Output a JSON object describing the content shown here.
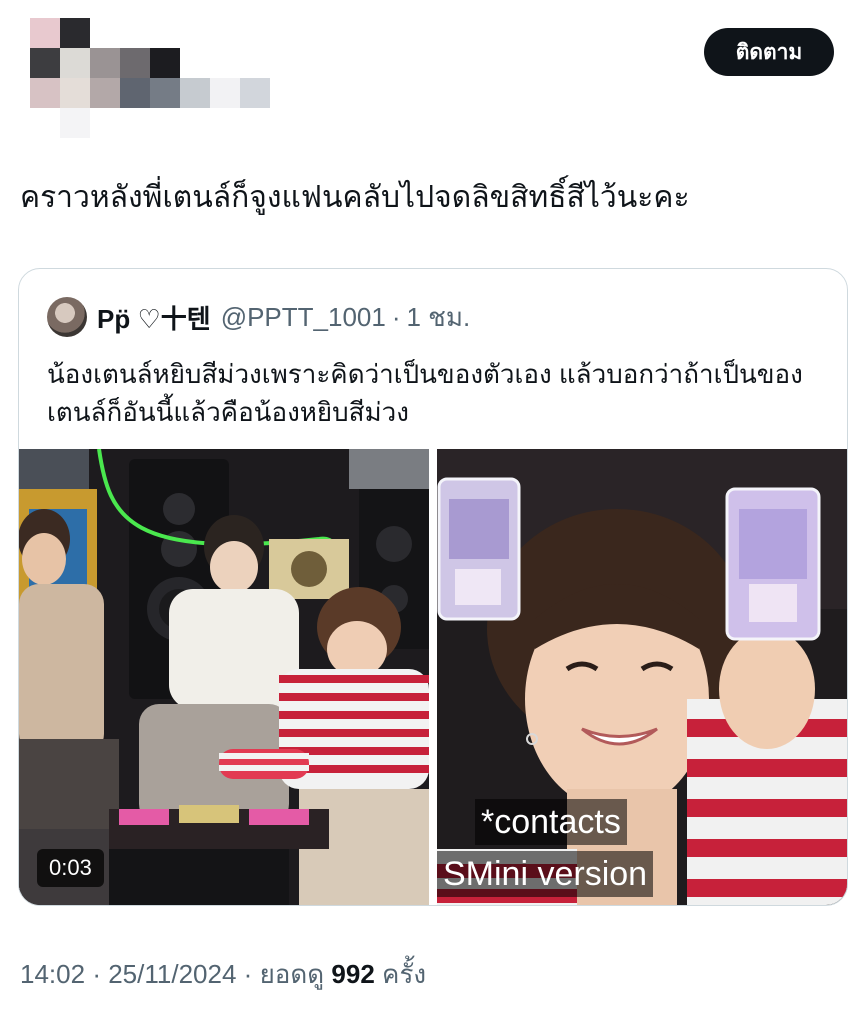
{
  "header": {
    "follow_label": "ติดตาม"
  },
  "tweet": {
    "text": "คราวหลังพี่เตนล์ก็จูงแฟนคลับไปจดลิขสิทธิ์สีไว้นะคะ"
  },
  "quoted": {
    "display_name": "Pp̈ ♡十텐",
    "handle": "@PPTT_1001",
    "separator": "·",
    "time": "1 ชม.",
    "text": "น้องเตนล์หยิบสีม่วงเพราะคิดว่าเป็นของตัวเอง แล้วบอกว่าถ้าเป็นของเตนล์ก็อันนี้แล้วคือน้องหยิบสีม่วง",
    "media": {
      "video_duration": "0:03",
      "caption_line1": "*contacts",
      "caption_line2": "SMini version"
    }
  },
  "footer": {
    "time": "14:02",
    "dot1": "·",
    "date": "25/11/2024",
    "dot2": "·",
    "views_prefix": "ยอดดู",
    "views_count": "992",
    "views_suffix": "ครั้ง"
  },
  "colors": {
    "text_primary": "#0f1419",
    "text_secondary": "#536471",
    "border": "#cfd9de",
    "button_bg": "#0f1419"
  }
}
